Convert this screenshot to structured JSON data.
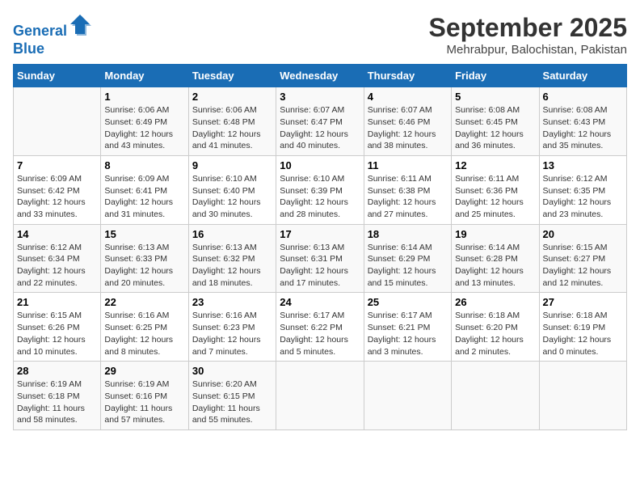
{
  "logo": {
    "line1": "General",
    "line2": "Blue"
  },
  "title": "September 2025",
  "location": "Mehrabpur, Balochistan, Pakistan",
  "weekdays": [
    "Sunday",
    "Monday",
    "Tuesday",
    "Wednesday",
    "Thursday",
    "Friday",
    "Saturday"
  ],
  "weeks": [
    [
      {
        "day": "",
        "info": ""
      },
      {
        "day": "1",
        "info": "Sunrise: 6:06 AM\nSunset: 6:49 PM\nDaylight: 12 hours\nand 43 minutes."
      },
      {
        "day": "2",
        "info": "Sunrise: 6:06 AM\nSunset: 6:48 PM\nDaylight: 12 hours\nand 41 minutes."
      },
      {
        "day": "3",
        "info": "Sunrise: 6:07 AM\nSunset: 6:47 PM\nDaylight: 12 hours\nand 40 minutes."
      },
      {
        "day": "4",
        "info": "Sunrise: 6:07 AM\nSunset: 6:46 PM\nDaylight: 12 hours\nand 38 minutes."
      },
      {
        "day": "5",
        "info": "Sunrise: 6:08 AM\nSunset: 6:45 PM\nDaylight: 12 hours\nand 36 minutes."
      },
      {
        "day": "6",
        "info": "Sunrise: 6:08 AM\nSunset: 6:43 PM\nDaylight: 12 hours\nand 35 minutes."
      }
    ],
    [
      {
        "day": "7",
        "info": "Sunrise: 6:09 AM\nSunset: 6:42 PM\nDaylight: 12 hours\nand 33 minutes."
      },
      {
        "day": "8",
        "info": "Sunrise: 6:09 AM\nSunset: 6:41 PM\nDaylight: 12 hours\nand 31 minutes."
      },
      {
        "day": "9",
        "info": "Sunrise: 6:10 AM\nSunset: 6:40 PM\nDaylight: 12 hours\nand 30 minutes."
      },
      {
        "day": "10",
        "info": "Sunrise: 6:10 AM\nSunset: 6:39 PM\nDaylight: 12 hours\nand 28 minutes."
      },
      {
        "day": "11",
        "info": "Sunrise: 6:11 AM\nSunset: 6:38 PM\nDaylight: 12 hours\nand 27 minutes."
      },
      {
        "day": "12",
        "info": "Sunrise: 6:11 AM\nSunset: 6:36 PM\nDaylight: 12 hours\nand 25 minutes."
      },
      {
        "day": "13",
        "info": "Sunrise: 6:12 AM\nSunset: 6:35 PM\nDaylight: 12 hours\nand 23 minutes."
      }
    ],
    [
      {
        "day": "14",
        "info": "Sunrise: 6:12 AM\nSunset: 6:34 PM\nDaylight: 12 hours\nand 22 minutes."
      },
      {
        "day": "15",
        "info": "Sunrise: 6:13 AM\nSunset: 6:33 PM\nDaylight: 12 hours\nand 20 minutes."
      },
      {
        "day": "16",
        "info": "Sunrise: 6:13 AM\nSunset: 6:32 PM\nDaylight: 12 hours\nand 18 minutes."
      },
      {
        "day": "17",
        "info": "Sunrise: 6:13 AM\nSunset: 6:31 PM\nDaylight: 12 hours\nand 17 minutes."
      },
      {
        "day": "18",
        "info": "Sunrise: 6:14 AM\nSunset: 6:29 PM\nDaylight: 12 hours\nand 15 minutes."
      },
      {
        "day": "19",
        "info": "Sunrise: 6:14 AM\nSunset: 6:28 PM\nDaylight: 12 hours\nand 13 minutes."
      },
      {
        "day": "20",
        "info": "Sunrise: 6:15 AM\nSunset: 6:27 PM\nDaylight: 12 hours\nand 12 minutes."
      }
    ],
    [
      {
        "day": "21",
        "info": "Sunrise: 6:15 AM\nSunset: 6:26 PM\nDaylight: 12 hours\nand 10 minutes."
      },
      {
        "day": "22",
        "info": "Sunrise: 6:16 AM\nSunset: 6:25 PM\nDaylight: 12 hours\nand 8 minutes."
      },
      {
        "day": "23",
        "info": "Sunrise: 6:16 AM\nSunset: 6:23 PM\nDaylight: 12 hours\nand 7 minutes."
      },
      {
        "day": "24",
        "info": "Sunrise: 6:17 AM\nSunset: 6:22 PM\nDaylight: 12 hours\nand 5 minutes."
      },
      {
        "day": "25",
        "info": "Sunrise: 6:17 AM\nSunset: 6:21 PM\nDaylight: 12 hours\nand 3 minutes."
      },
      {
        "day": "26",
        "info": "Sunrise: 6:18 AM\nSunset: 6:20 PM\nDaylight: 12 hours\nand 2 minutes."
      },
      {
        "day": "27",
        "info": "Sunrise: 6:18 AM\nSunset: 6:19 PM\nDaylight: 12 hours\nand 0 minutes."
      }
    ],
    [
      {
        "day": "28",
        "info": "Sunrise: 6:19 AM\nSunset: 6:18 PM\nDaylight: 11 hours\nand 58 minutes."
      },
      {
        "day": "29",
        "info": "Sunrise: 6:19 AM\nSunset: 6:16 PM\nDaylight: 11 hours\nand 57 minutes."
      },
      {
        "day": "30",
        "info": "Sunrise: 6:20 AM\nSunset: 6:15 PM\nDaylight: 11 hours\nand 55 minutes."
      },
      {
        "day": "",
        "info": ""
      },
      {
        "day": "",
        "info": ""
      },
      {
        "day": "",
        "info": ""
      },
      {
        "day": "",
        "info": ""
      }
    ]
  ]
}
